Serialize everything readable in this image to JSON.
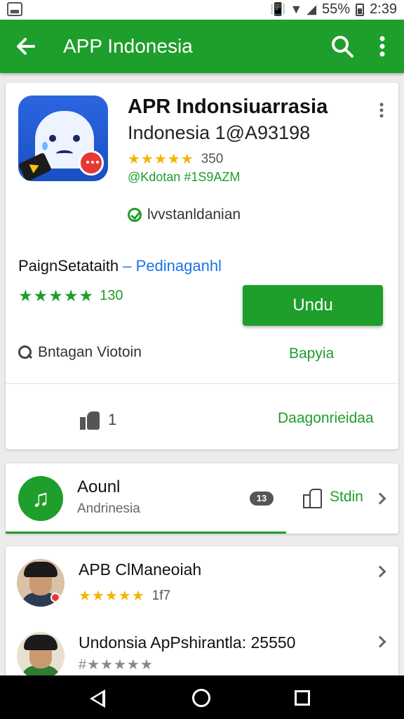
{
  "status_bar": {
    "battery": "55%",
    "time": "2:39",
    "icons": [
      "sim-icon",
      "vibrate-icon",
      "wifi-icon",
      "signal-icon",
      "battery-icon"
    ]
  },
  "app_bar": {
    "title": "APP Indonesia",
    "icons": [
      "back-arrow-icon",
      "search-icon",
      "more-vert-icon"
    ],
    "color": "#1e9e2a"
  },
  "app_card": {
    "name": "APR Indonsiuarrasia",
    "subtitle": "Indonesia 1@A93198",
    "rating_stars": "★★★★★",
    "rating_count": "350",
    "developer_line": "@Kdotan #1S9AZM",
    "verified_label": "lvvstanldanian",
    "publisher": "PaignSetataith",
    "publisher_sep": "–",
    "publisher_link": "Pedinaganhl",
    "rating2_stars": "★★★★★",
    "rating2_count": "130",
    "install_label": "Undu",
    "search_label": "Bntagan Viotoin",
    "right_link": "Bapyia",
    "likes_count": "1",
    "bottom_link": "Daagonrieidaa"
  },
  "music_card": {
    "title": "Aounl",
    "subtitle": "Andrinesia",
    "pill_label": "13",
    "share_label": "Stdin"
  },
  "people_list": [
    {
      "title": "APB ClManeoiah",
      "stars": "★★★★★",
      "count": "1f7"
    },
    {
      "title": "Undonsia ApPshirantla: 25550",
      "stars": "#★★★★★"
    }
  ]
}
